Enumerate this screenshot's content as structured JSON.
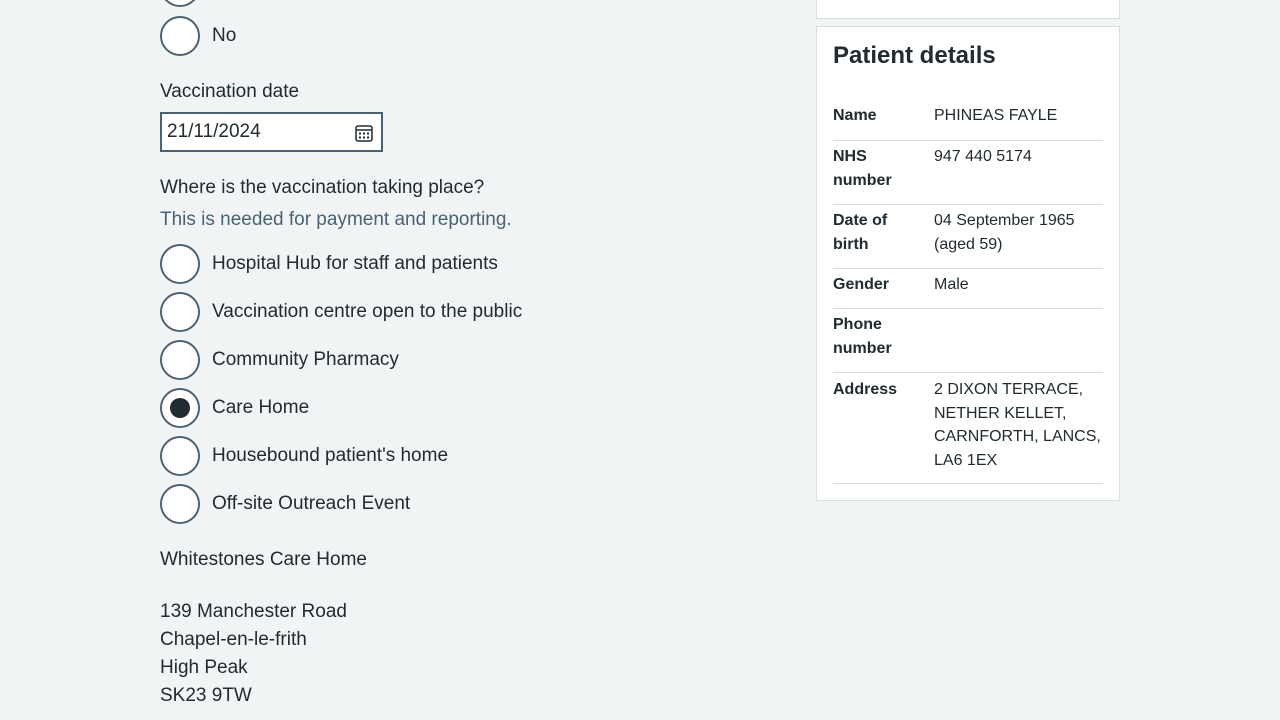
{
  "form": {
    "previous_radio_label": "No",
    "vaccination_date": {
      "label": "Vaccination date",
      "value": "21/11/2024"
    },
    "location_question": {
      "label": "Where is the vaccination taking place?",
      "hint": "This is needed for payment and reporting.",
      "options": [
        {
          "label": "Hospital Hub for staff and patients",
          "checked": false
        },
        {
          "label": "Vaccination centre open to the public",
          "checked": false
        },
        {
          "label": "Community Pharmacy",
          "checked": false
        },
        {
          "label": "Care Home",
          "checked": true
        },
        {
          "label": "Housebound patient's home",
          "checked": false
        },
        {
          "label": "Off-site Outreach Event",
          "checked": false
        }
      ]
    },
    "care_home": {
      "name": "Whitestones Care Home",
      "address_lines": [
        "139 Manchester Road",
        "Chapel-en-le-frith",
        "High Peak",
        "SK23 9TW"
      ]
    }
  },
  "patient_details": {
    "title": "Patient details",
    "rows": [
      {
        "key": "Name",
        "value": "PHINEAS FAYLE"
      },
      {
        "key": "NHS number",
        "value": "947 440 5174"
      },
      {
        "key": "Date of birth",
        "value": "04 September 1965 (aged 59)"
      },
      {
        "key": "Gender",
        "value": "Male"
      },
      {
        "key": "Phone number",
        "value": ""
      },
      {
        "key": "Address",
        "value": "2 DIXON TERRACE, NETHER KELLET, CARNFORTH, LANCS, LA6 1EX"
      }
    ]
  },
  "colors": {
    "background": "#f0f4f5",
    "text": "#212b32",
    "hint": "#4c6272",
    "border": "#d8dde0"
  }
}
